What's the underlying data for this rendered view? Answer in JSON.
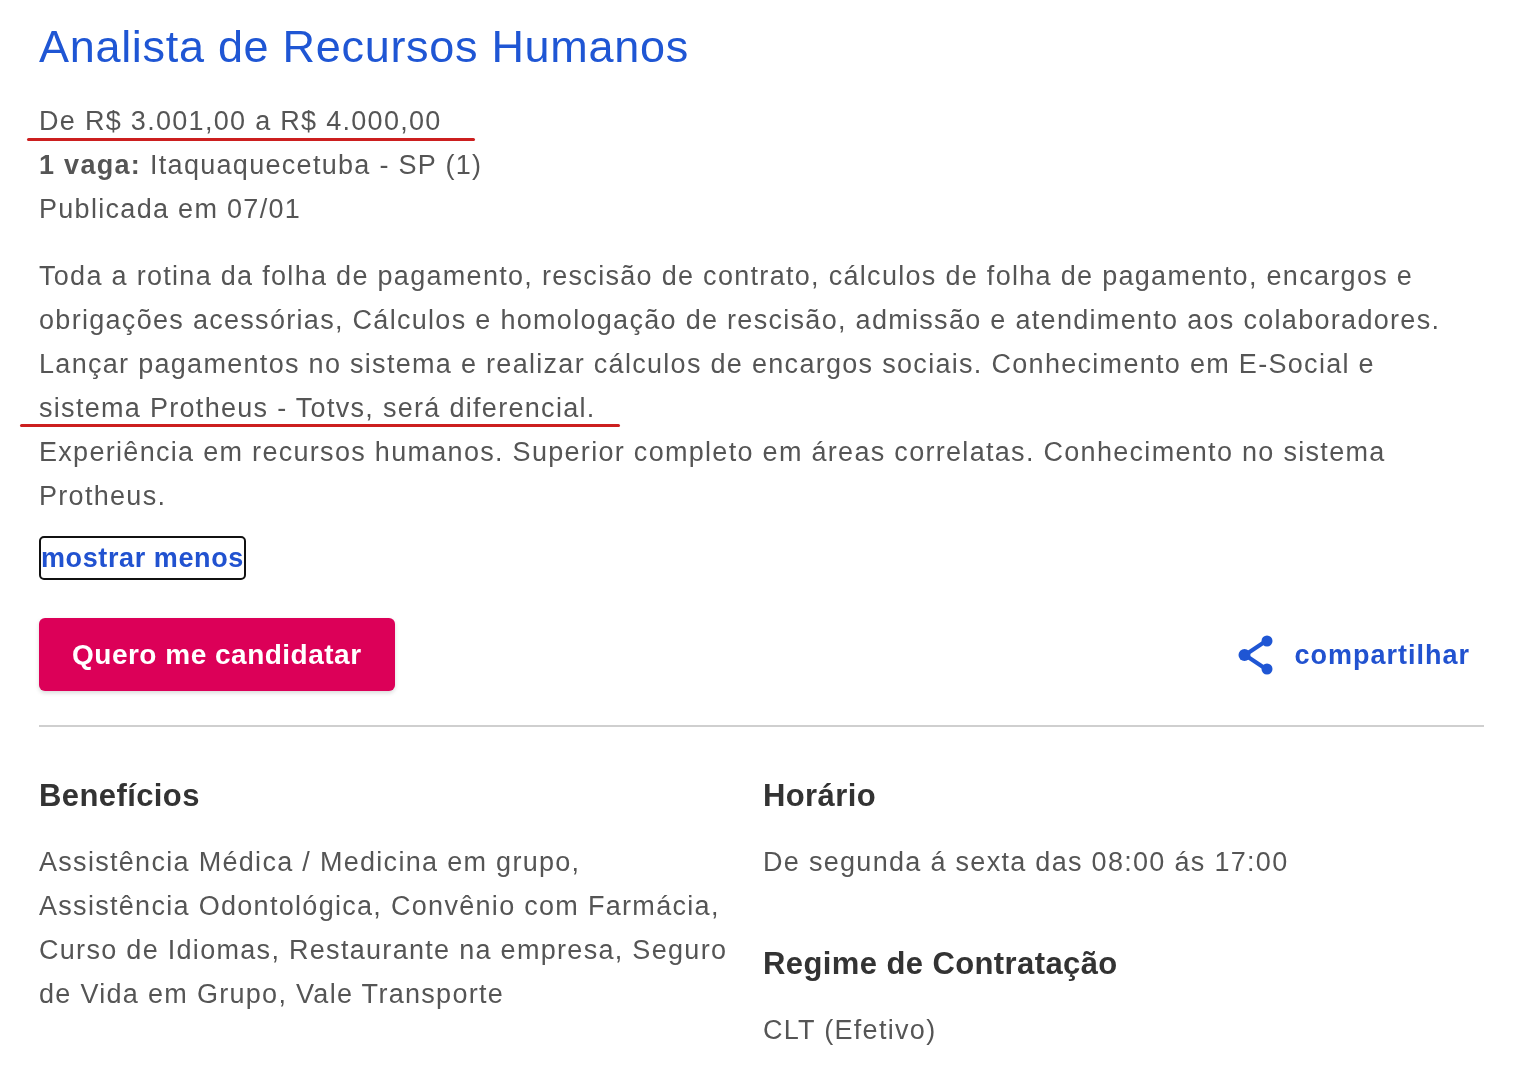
{
  "job": {
    "title": "Analista de Recursos Humanos",
    "salary": {
      "text": "De R$ 3.001,00 a R$ 4.000,00",
      "underlined": true
    },
    "vacancy": "**1 vaga:** Itaquaquecetuba - SP (1)",
    "published": "Publicada em 07/01"
  },
  "description": [
    {
      "text": "Toda a rotina da folha de pagamento, rescisão de contrato, cálculos de folha de pagamento, encargos e obrigações acessórias, Cálculos e homologação de rescisão, admissão e atendimento aos colaboradores. Lançar pagamentos no sistema e realizar cálculos de encargos sociais. Conhecimento em E-Social e sistema Protheus - Totvs, será diferencial.",
      "underlined": true
    },
    {
      "text": "Experiência em recursos humanos. Superior completo em áreas correlatas. Conhecimento no sistema Protheus.",
      "underlined": false
    }
  ],
  "toggle_link": {
    "label": "mostrar menos",
    "focused": true
  },
  "actions": {
    "apply_button": "Quero me candidatar",
    "share_link": "compartilhar"
  },
  "details": {
    "columns": [
      [
        {
          "heading": "Benefícios",
          "text": "Assistência Médica / Medicina em grupo, Assistência Odontológica, Convênio com Farmácia, Curso de Idiomas, Restaurante na empresa, Seguro de Vida em Grupo, Vale Transporte"
        }
      ],
      [
        {
          "heading": "Horário",
          "text": "De segunda á sexta das 08:00 ás 17:00"
        },
        {
          "heading": "Regime de Contratação",
          "text": "CLT (Efetivo)"
        }
      ]
    ]
  }
}
